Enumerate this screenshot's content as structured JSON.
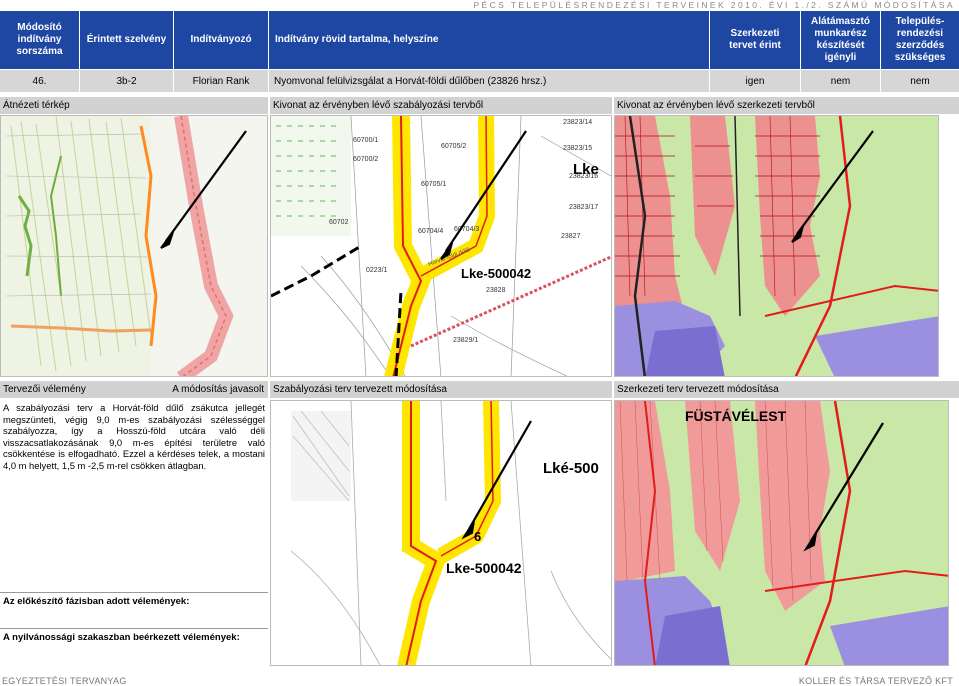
{
  "page": {
    "top_title": "PÉCS TELEPÜLÉSRENDEZÉSI TERVEINEK 2010. ÉVI 1./2. SZÁMÚ MÓDOSÍTÁSA",
    "footer_left": "EGYEZTETÉSI TERVANYAG",
    "footer_right": "KOLLER ÉS TÁRSA TERVEZŐ KFT"
  },
  "table": {
    "headers": {
      "modositando": "Módosító indítvány sorszáma",
      "erintett": "Érintett szelvény",
      "inditvanyozo": "Indítványozó",
      "rovid": "Indítvány rövid tartalma, helyszíne",
      "szerkezeti": "Szerkezeti tervet érint",
      "alatamaszto": "Alátámasztó munkarész készítését igényli",
      "telepules": "Település-rendezési szerződés szükséges"
    },
    "row": {
      "sorszam": "46.",
      "szelveny": "3b-2",
      "inditvanyozo": "Florian Rank",
      "tartalom": "Nyomvonal felülvizsgálat a Horvát-földi dűlőben (23826 hrsz.)",
      "szerkezeti": "igen",
      "alatamaszto": "nem",
      "telepules": "nem"
    }
  },
  "panels": {
    "atnezeti": "Átnézeti térkép",
    "kivonat_szab": "Kivonat az érvényben lévő szabályozási tervből",
    "kivonat_szerk": "Kivonat az érvényben lévő szerkezeti tervből",
    "tervezoi": "Tervezői vélemény",
    "javasolt": "A módosítás javasolt",
    "szab_modositas": "Szabályozási terv tervezett módosítása",
    "szerk_modositas": "Szerkezeti terv tervezett módosítása",
    "opinion_text": "A szabályozási terv a Horvát-föld dűlő zsákutca jellegét megszünteti, végig 9,0 m-es szabályozási szélességgel szabályozza, így a Hosszú-föld utcára való déli visszacsatlakozásának 9,0 m-es építési területre való csökkentése is elfogadható. Ezzel a kérdéses telek, a mostani 4,0 m helyett, 1,5 m -2,5 m-rel csökken átlagban.",
    "elokeszito": "Az előkészítő fázisban adott vélemények:",
    "nyilvanossagi": "A nyilvánossági szakaszban beérkezett vélemények:"
  },
  "maps": {
    "reg_labels": [
      "Lke-500042",
      "Lke",
      "60705/2",
      "60705/1",
      "60700/2",
      "60704/3",
      "60704/4",
      "23823/14",
      "23823/15",
      "23823/16",
      "23823/17",
      "23827",
      "23828",
      "23829/1",
      "60702",
      "60700/1",
      "0223/1"
    ],
    "reg_new_labels": [
      "Lke-500042",
      "Lké-500",
      "6"
    ],
    "struct_new_label": "FÜSTÁVÉLEST",
    "street_label": "Horvát-földi dűlő"
  },
  "colors": {
    "header_blue": "#1e46a3",
    "row_grey": "#d6d6d6",
    "road_yellow": "#ffe600",
    "road_red": "#e31b1b",
    "zone_pink": "#f09a9a",
    "zone_green": "#c8e6a0",
    "zone_purple": "#9b8fe0"
  }
}
